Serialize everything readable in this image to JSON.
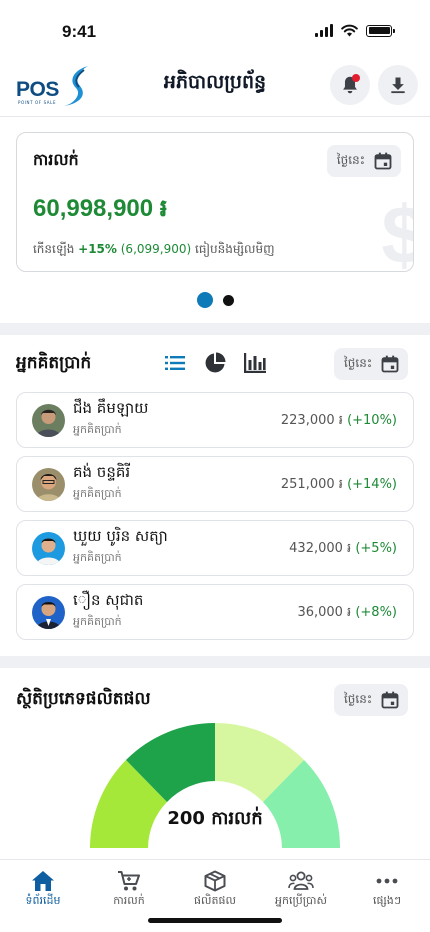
{
  "status_bar": {
    "time": "9:41"
  },
  "header": {
    "logo_text": "POS",
    "logo_subtext": "POINT OF SALE",
    "title": "អភិបាលប្រព័ន្ធ",
    "notification_icon": "bell-icon",
    "download_icon": "download-icon"
  },
  "sales_card": {
    "title": "ការលក់",
    "date_filter": "ថ្ងៃនេះ",
    "amount": "60,998,900 ៛",
    "growth_prefix": "កើនឡើង",
    "growth_percent": "+15%",
    "growth_amount": "(6,099,900)",
    "growth_suffix": "ធៀបនិងម្សិលមិញ",
    "watermark": "$"
  },
  "carousel": {
    "pages": 2,
    "active": 0
  },
  "cashiers": {
    "title": "អ្នកគិតប្រាក់",
    "date_filter": "ថ្ងៃនេះ",
    "view_icons": [
      "list-icon",
      "pie-chart-icon",
      "bar-chart-icon"
    ],
    "items": [
      {
        "name": "ជឹង គឹមឡាយ",
        "role": "អ្នកគិតប្រាក់",
        "amount": "223,000 ៛",
        "change": "(+10%)"
      },
      {
        "name": "គង់ ចន្ទគិរី",
        "role": "អ្នកគិតប្រាក់",
        "amount": "251,000 ៛",
        "change": "(+14%)"
      },
      {
        "name": "ឃួយ បូរិន សត្យា",
        "role": "អ្នកគិតប្រាក់",
        "amount": "432,000 ៛",
        "change": "(+5%)"
      },
      {
        "name": "ឿន សុជាត",
        "role": "អ្នកគិតប្រាក់",
        "amount": "36,000 ៛",
        "change": "(+8%)"
      }
    ]
  },
  "product_stats": {
    "title": "ស្ថិតិប្រភេទផលិតផល",
    "date_filter": "ថ្ងៃនេះ",
    "gauge_label": "200 ការលក់",
    "segment_colors": [
      "#a6e83a",
      "#1fa34a",
      "#d6f7a0",
      "#86efac"
    ]
  },
  "tab_bar": {
    "items": [
      {
        "label": "ទំព័រដើម",
        "icon": "home-icon",
        "active": true
      },
      {
        "label": "ការលក់",
        "icon": "cart-icon",
        "active": false
      },
      {
        "label": "ផលិតផល",
        "icon": "box-icon",
        "active": false
      },
      {
        "label": "អ្នកប្រើប្រាស់",
        "icon": "users-icon",
        "active": false
      },
      {
        "label": "ផ្សេងៗ",
        "icon": "more-icon",
        "active": false
      }
    ]
  }
}
